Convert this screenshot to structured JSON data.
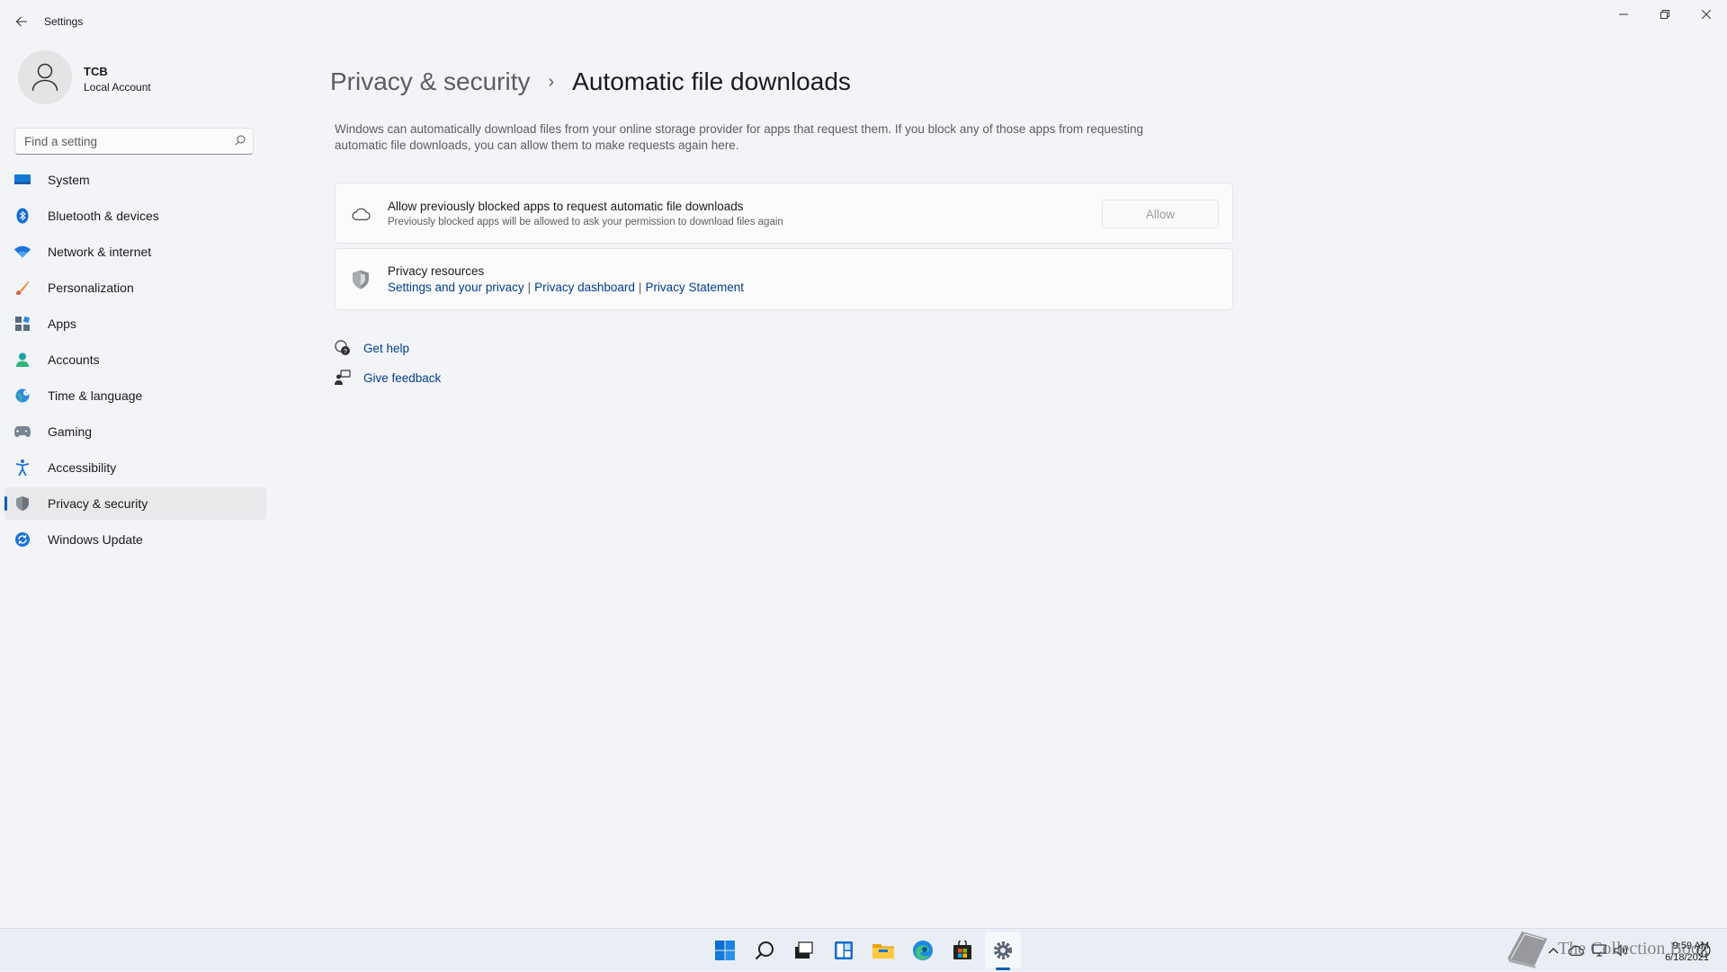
{
  "app": {
    "title": "Settings"
  },
  "profile": {
    "name": "TCB",
    "account_type": "Local Account"
  },
  "search": {
    "placeholder": "Find a setting"
  },
  "sidebar": {
    "items": [
      {
        "label": "System",
        "icon": "monitor-icon"
      },
      {
        "label": "Bluetooth & devices",
        "icon": "bluetooth-icon"
      },
      {
        "label": "Network & internet",
        "icon": "wifi-icon"
      },
      {
        "label": "Personalization",
        "icon": "brush-icon"
      },
      {
        "label": "Apps",
        "icon": "apps-icon"
      },
      {
        "label": "Accounts",
        "icon": "person-icon"
      },
      {
        "label": "Time & language",
        "icon": "globe-clock-icon"
      },
      {
        "label": "Gaming",
        "icon": "gamepad-icon"
      },
      {
        "label": "Accessibility",
        "icon": "accessibility-icon"
      },
      {
        "label": "Privacy & security",
        "icon": "shield-icon",
        "selected": true
      },
      {
        "label": "Windows Update",
        "icon": "update-icon"
      }
    ]
  },
  "breadcrumb": {
    "parent": "Privacy & security",
    "separator": "›",
    "current": "Automatic file downloads"
  },
  "description": "Windows can automatically download files from your online storage provider for apps that request them. If you block any of those apps from requesting automatic file downloads, you can allow them to make requests again here.",
  "allow_card": {
    "title": "Allow previously blocked apps to request automatic file downloads",
    "subtitle": "Previously blocked apps will be allowed to ask your permission to download files again",
    "button": "Allow",
    "button_enabled": false
  },
  "privacy_card": {
    "title": "Privacy resources",
    "links": [
      "Settings and your privacy",
      "Privacy dashboard",
      "Privacy Statement"
    ],
    "separator": "|"
  },
  "help": {
    "get_help": "Get help",
    "give_feedback": "Give feedback"
  },
  "taskbar": {
    "apps": [
      "start-icon",
      "search-icon",
      "task-view-icon",
      "widgets-icon",
      "file-explorer-icon",
      "edge-icon",
      "store-icon",
      "settings-icon"
    ],
    "active_app": "settings-icon",
    "time": "9:59 AM",
    "date": "6/18/2021"
  },
  "watermark": {
    "text": "The Collection Book"
  },
  "colors": {
    "accent": "#005fb8",
    "link": "#003e92",
    "background": "#f3f4f8"
  }
}
